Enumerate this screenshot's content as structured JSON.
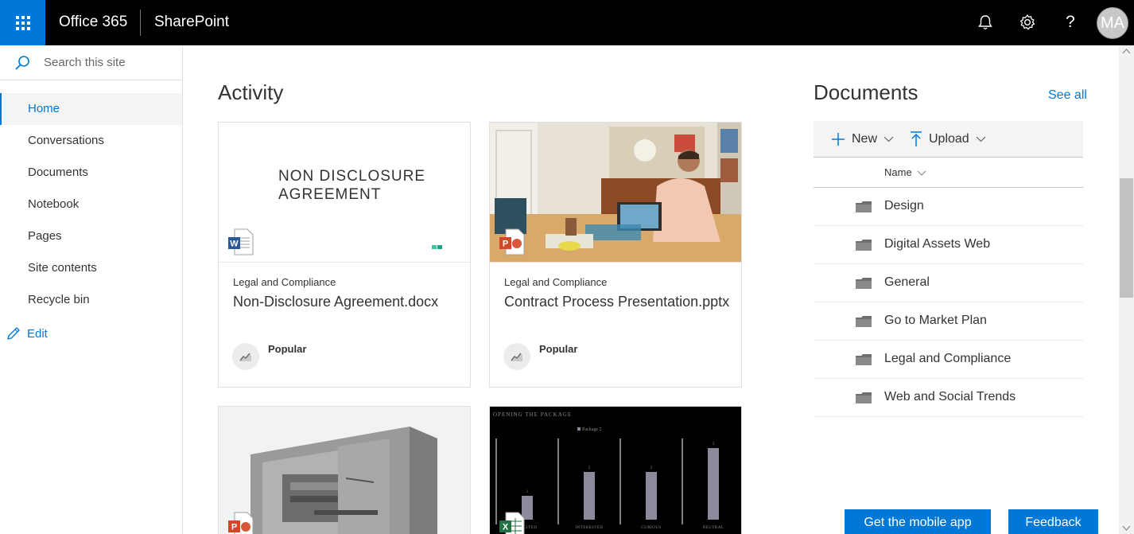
{
  "topbar": {
    "brand": "Office 365",
    "app": "SharePoint",
    "avatar_initials": "MA",
    "icons": [
      "waffle-icon",
      "bell-icon",
      "gear-icon",
      "help-icon"
    ],
    "help_glyph": "?"
  },
  "leftnav": {
    "search_placeholder": "Search this site",
    "items": [
      {
        "label": "Home",
        "active": true
      },
      {
        "label": "Conversations"
      },
      {
        "label": "Documents"
      },
      {
        "label": "Notebook"
      },
      {
        "label": "Pages"
      },
      {
        "label": "Site contents"
      },
      {
        "label": "Recycle bin"
      }
    ],
    "edit_label": "Edit"
  },
  "activity": {
    "title": "Activity",
    "cards": [
      {
        "site": "Legal and Compliance",
        "file": "Non-Disclosure Agreement.docx",
        "badge": "Popular",
        "thumb_text": "NON DISCLOSURE AGREEMENT",
        "file_type": "word"
      },
      {
        "site": "Legal and Compliance",
        "file": "Contract Process Presentation.pptx",
        "badge": "Popular",
        "file_type": "powerpoint"
      },
      {
        "file_type": "powerpoint"
      },
      {
        "file_type": "excel",
        "thumb_title": "OPENING THE PACKAGE",
        "thumb_legend": "Package 2",
        "thumb_categories": [
          "EXCITED",
          "INTERESTED",
          "CURIOUS",
          "NEUTRAL"
        ],
        "thumb_values": [
          1,
          2,
          2,
          3
        ]
      }
    ]
  },
  "documents": {
    "title": "Documents",
    "see_all": "See all",
    "new_label": "New",
    "upload_label": "Upload",
    "column_name": "Name",
    "folders": [
      "Design",
      "Digital Assets Web",
      "General",
      "Go to Market Plan",
      "Legal and Compliance",
      "Web and Social Trends"
    ]
  },
  "footer": {
    "mobile_app": "Get the mobile app",
    "feedback": "Feedback"
  },
  "colors": {
    "accent": "#0078d7",
    "topbar": "#000000"
  }
}
